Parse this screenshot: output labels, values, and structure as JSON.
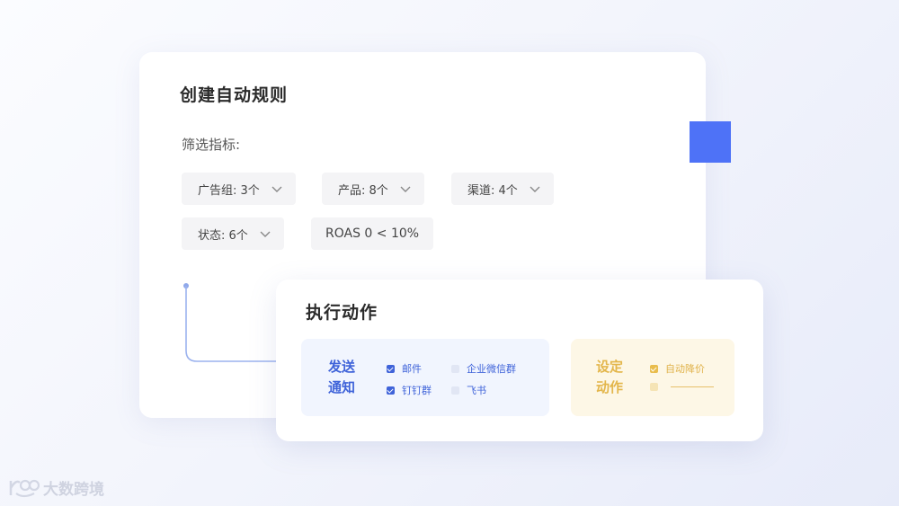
{
  "rule_card": {
    "title": "创建自动规则",
    "filter_label": "筛选指标:",
    "chips": [
      {
        "label": "广告组: 3个"
      },
      {
        "label": "产品: 8个"
      },
      {
        "label": "渠道: 4个"
      },
      {
        "label": "状态: 6个"
      },
      {
        "label": "ROAS 0 < 10%"
      }
    ]
  },
  "action_card": {
    "title": "执行动作",
    "notify": {
      "label": "发送通知",
      "options": [
        {
          "label": "邮件",
          "checked": true
        },
        {
          "label": "企业微信群",
          "checked": false
        },
        {
          "label": "钉钉群",
          "checked": true
        },
        {
          "label": "飞书",
          "checked": false
        }
      ]
    },
    "preset": {
      "label": "设定动作",
      "options": [
        {
          "label": "自动降价",
          "checked": true
        },
        {
          "label": "",
          "checked": false
        }
      ]
    }
  },
  "watermark": {
    "text": "大数跨境"
  },
  "colors": {
    "accent_blue": "#4e72f7",
    "notify_blue": "#3f63d9",
    "preset_yellow": "#e3b64b"
  }
}
